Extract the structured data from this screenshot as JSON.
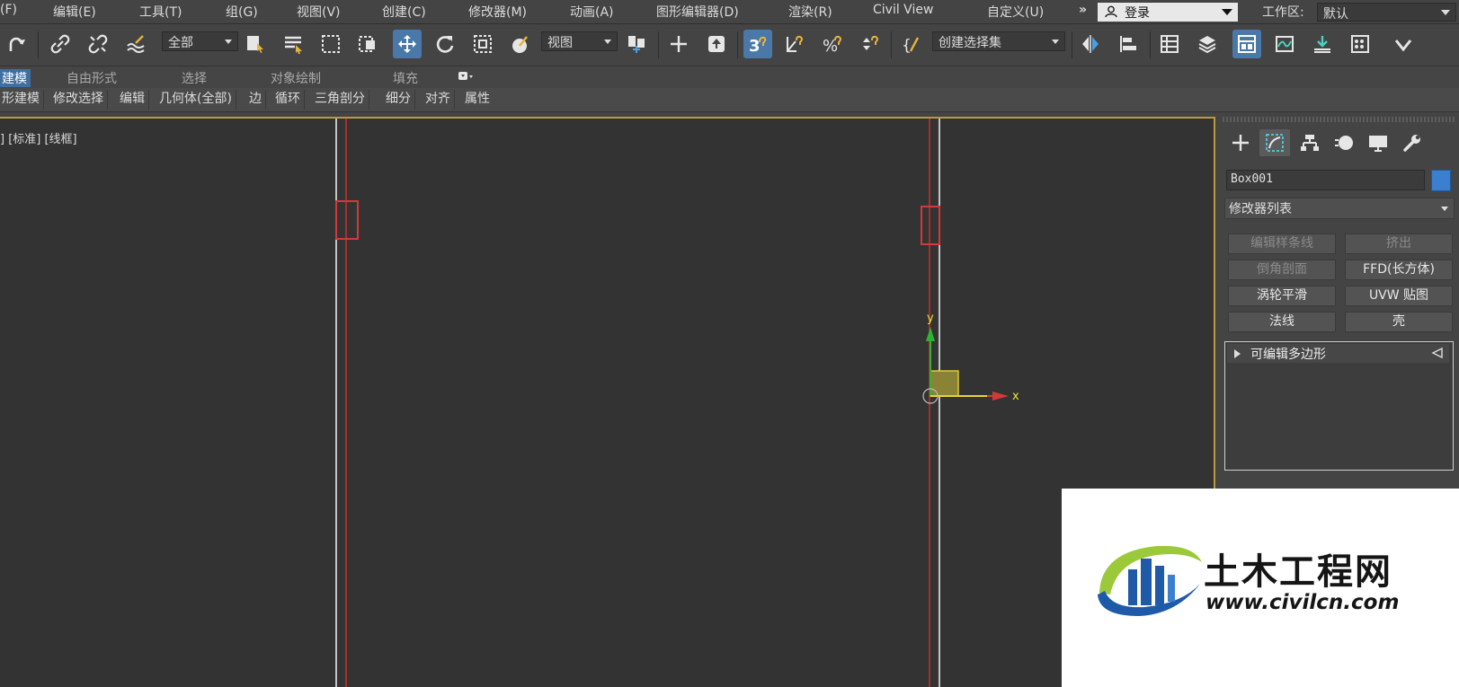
{
  "menu": {
    "items": [
      "(F)",
      "编辑(E)",
      "工具(T)",
      "组(G)",
      "视图(V)",
      "创建(C)",
      "修改器(M)",
      "动画(A)",
      "图形编辑器(D)",
      "渲染(R)",
      "Civil View",
      "自定义(U)"
    ],
    "overflow": "»",
    "login": "登录",
    "workspace_label": "工作区:",
    "workspace_value": "默认"
  },
  "toolbar": {
    "selection_filter": "全部",
    "ref_coord": "视图",
    "named_selection": "创建选择集"
  },
  "ribbon": {
    "tabs": [
      "建模",
      "自由形式",
      "选择",
      "对象绘制",
      "填充"
    ],
    "active_tab": "建模",
    "tools": [
      "形建模",
      "修改选择",
      "编辑",
      "几何体(全部)",
      "边",
      "循环",
      "三角剖分",
      "细分",
      "对齐",
      "属性"
    ]
  },
  "viewport": {
    "label": "] [标准] [线框]",
    "gizmo": {
      "x_label": "x",
      "y_label": "y"
    }
  },
  "command_panel": {
    "object_name": "Box001",
    "object_color": "#3a7fd0",
    "modifier_list": "修改器列表",
    "modifier_buttons": [
      {
        "label": "编辑样条线",
        "enabled": false
      },
      {
        "label": "挤出",
        "enabled": false
      },
      {
        "label": "倒角剖面",
        "enabled": false
      },
      {
        "label": "FFD(长方体)",
        "enabled": true
      },
      {
        "label": "涡轮平滑",
        "enabled": true
      },
      {
        "label": "UVW 贴图",
        "enabled": true
      },
      {
        "label": "法线",
        "enabled": true
      },
      {
        "label": "壳",
        "enabled": true
      }
    ],
    "stack_item": "可编辑多边形"
  },
  "watermark": {
    "title": "土木工程网",
    "url": "www.civilcn.com"
  },
  "colors": {
    "viewport_border": "#b99c39",
    "selection_red": "#d23a3a",
    "active_blue": "#4a78a8"
  }
}
